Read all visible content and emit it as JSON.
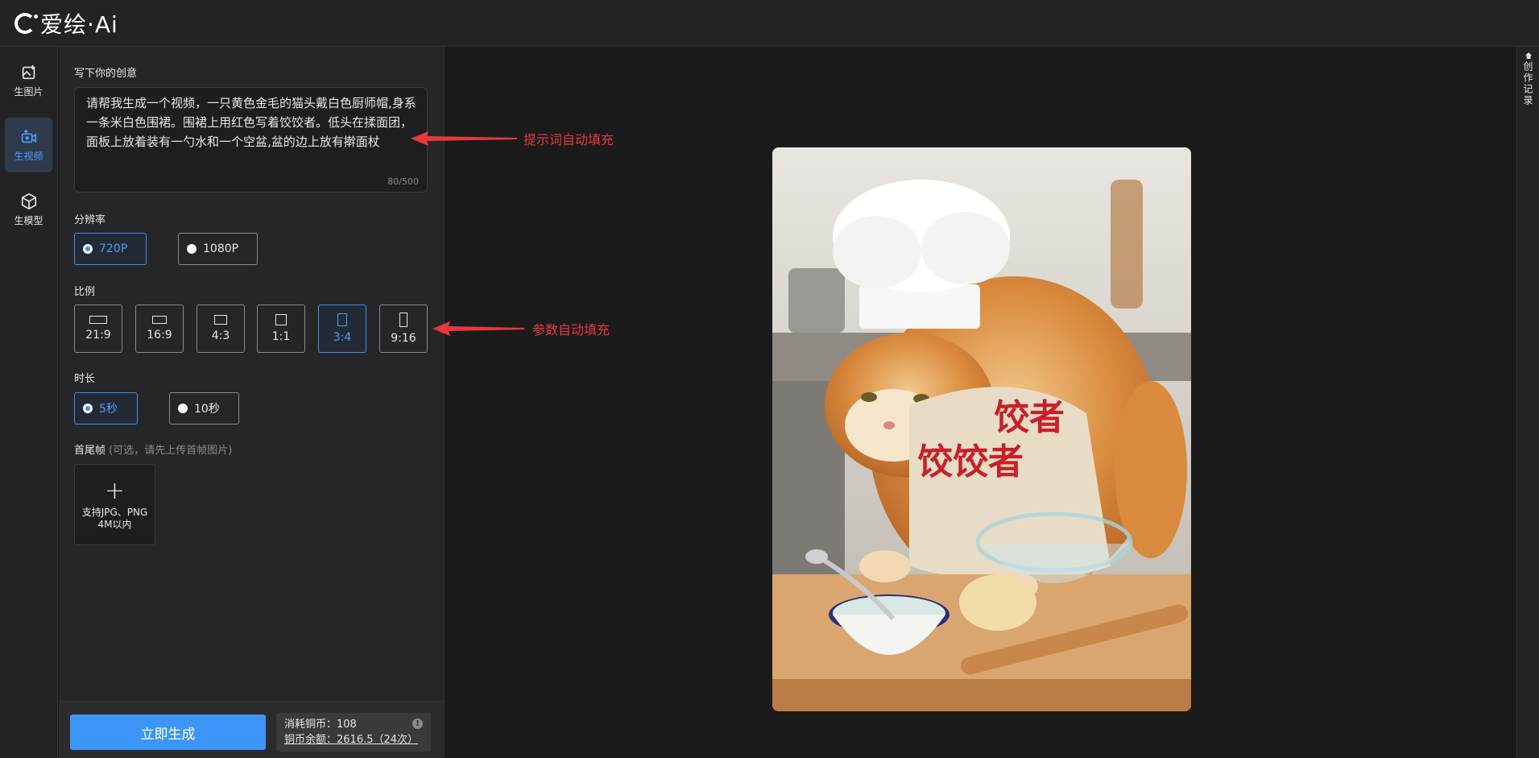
{
  "app": {
    "logo_text": "爱绘·Ai"
  },
  "nav": {
    "items": [
      {
        "label": "生图片",
        "icon": "image-generate-icon"
      },
      {
        "label": "生视频",
        "icon": "video-generate-icon",
        "active": true
      },
      {
        "label": "生模型",
        "icon": "3d-model-icon"
      }
    ]
  },
  "prompt": {
    "label": "写下你的创意",
    "value": "请帮我生成一个视频，一只黄色金毛的猫头戴白色厨师帽,身系一条米白色围裙。围裙上用红色写着饺饺者。低头在揉面团，面板上放着装有一勺水和一个空盆,盆的边上放有擀面杖",
    "counter": "80/500"
  },
  "resolution": {
    "label": "分辨率",
    "options": [
      "720P",
      "1080P"
    ],
    "selected": "720P"
  },
  "ratio": {
    "label": "比例",
    "options": [
      "21:9",
      "16:9",
      "4:3",
      "1:1",
      "3:4",
      "9:16"
    ],
    "selected": "3:4"
  },
  "duration": {
    "label": "时长",
    "options": [
      "5秒",
      "10秒"
    ],
    "selected": "5秒"
  },
  "frames": {
    "label": "首尾帧",
    "hint": "(可选，请先上传首帧图片)",
    "upload_line1": "支持JPG、PNG",
    "upload_line2": "4M以内"
  },
  "footer": {
    "generate_label": "立即生成",
    "cost_text": "消耗铜币：108",
    "balance_text": "铜币余额：2616.5（24次）"
  },
  "right_panel": {
    "label": "创作记录"
  },
  "annotations": {
    "prompt_note": "提示词自动填充",
    "params_note": "参数自动填充"
  },
  "preview": {
    "apron_text_line1": "饺者",
    "apron_text_line2": "饺饺者"
  },
  "colors": {
    "accent": "#3d95f7",
    "annotation": "#e8383d",
    "background": "#1b1b1c"
  }
}
